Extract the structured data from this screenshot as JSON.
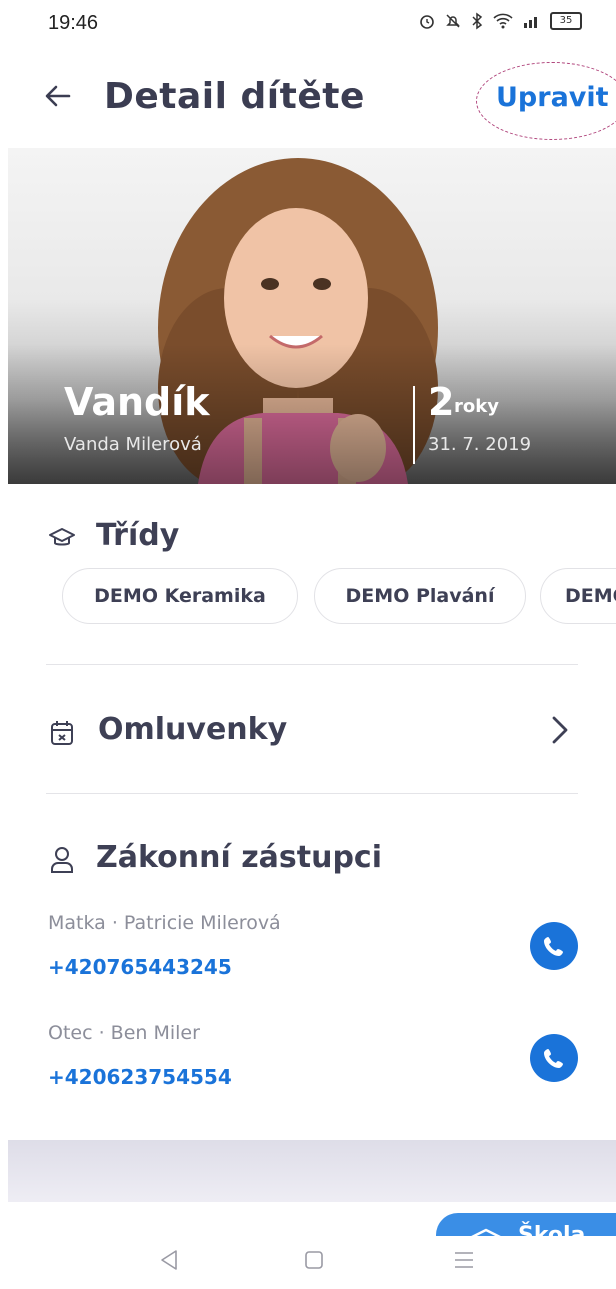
{
  "status_bar": {
    "time": "19:46",
    "icons": [
      "alarm-icon",
      "mute-icon",
      "bluetooth-icon",
      "wifi-icon",
      "signal-icon"
    ],
    "battery": "35"
  },
  "header": {
    "title": "Detail dítěte",
    "edit_label": "Upravit"
  },
  "child": {
    "nickname": "Vandík",
    "full_name": "Vanda Milerová",
    "age_number": "2",
    "age_unit": "roky",
    "birth_date": "31. 7. 2019"
  },
  "classes": {
    "title": "Třídy",
    "chips": [
      "DEMO Keramika",
      "DEMO Plavání",
      "DEMO"
    ]
  },
  "absences": {
    "title": "Omluvenky"
  },
  "guardians": {
    "title": "Zákonní zástupci",
    "items": [
      {
        "label": "Matka · Patricie Milerová",
        "phone": "+420765443245"
      },
      {
        "label": "Otec · Ben Miler",
        "phone": "+420623754554"
      }
    ]
  },
  "fab": {
    "label": "Škola"
  },
  "colors": {
    "accent": "#1a73d9",
    "text_dark": "#3e4055",
    "text_muted": "#8c8e9a",
    "annotation": "#b0457c"
  }
}
